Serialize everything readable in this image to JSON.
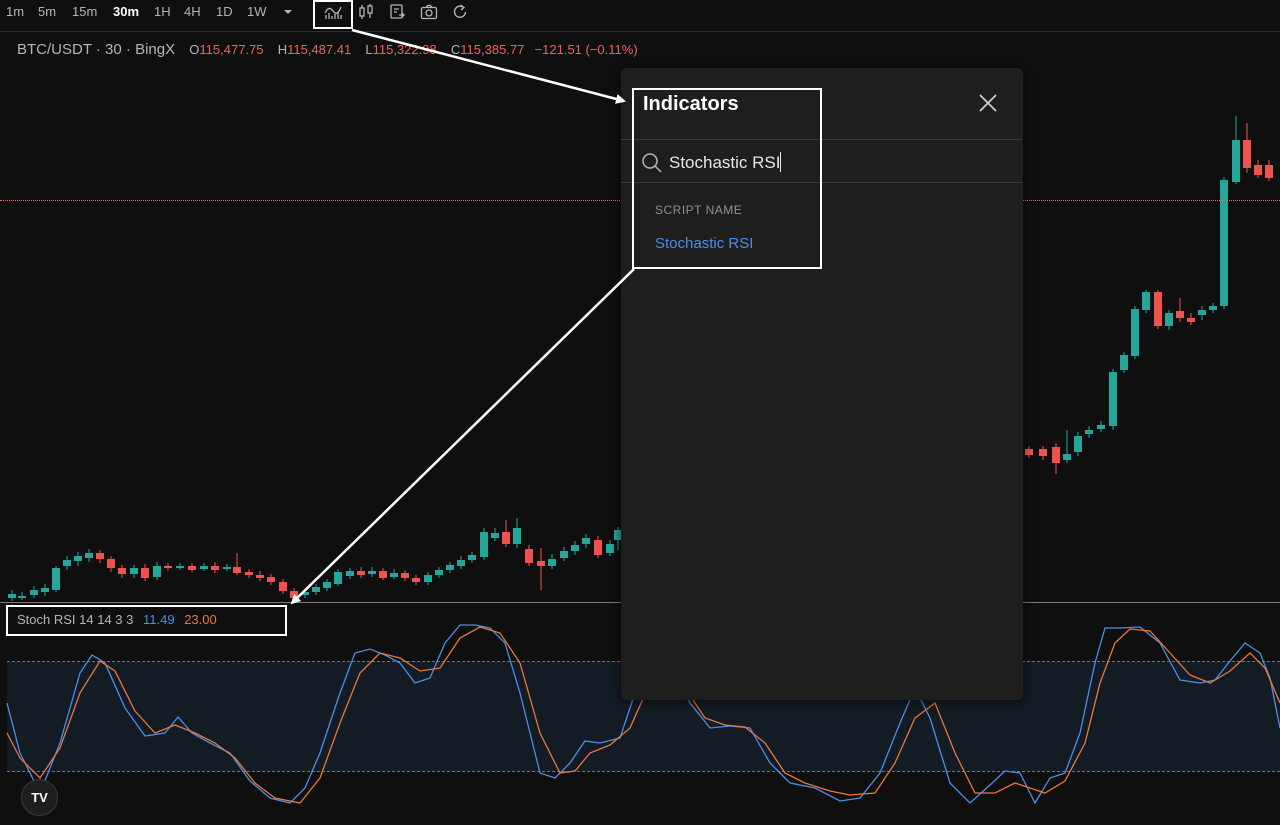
{
  "toolbar": {
    "timeframes": [
      "1m",
      "5m",
      "15m",
      "30m",
      "1H",
      "4H",
      "1D",
      "1W"
    ],
    "active_timeframe": "30m",
    "icons": [
      "chevron-down-icon",
      "indicators-icon",
      "candlestick-icon",
      "alert-icon",
      "camera-icon",
      "reset-icon"
    ]
  },
  "legend": {
    "symbol": "BTC/USDT · 30 · BingX",
    "open_label": "O",
    "open": "115,477.75",
    "high_label": "H",
    "high": "115,487.41",
    "low_label": "L",
    "low": "115,322.98",
    "close_label": "C",
    "close": "115,385.77",
    "change": "−121.51 (−0.11%)"
  },
  "stoch_legend": {
    "name": "Stoch RSI",
    "params": "14 14 3 3",
    "k_value": "11.49",
    "d_value": "23.00"
  },
  "dialog": {
    "title": "Indicators",
    "search_value": "Stochastic RSI",
    "section_label": "SCRIPT NAME",
    "result": "Stochastic RSI"
  },
  "logo": {
    "text": "TV"
  },
  "colors": {
    "up": "#26a69a",
    "down": "#ef5350",
    "k_line": "#4a8fe7",
    "d_line": "#e9773c",
    "accent_link": "#4a8fe7",
    "background": "#0f0f0f"
  }
}
